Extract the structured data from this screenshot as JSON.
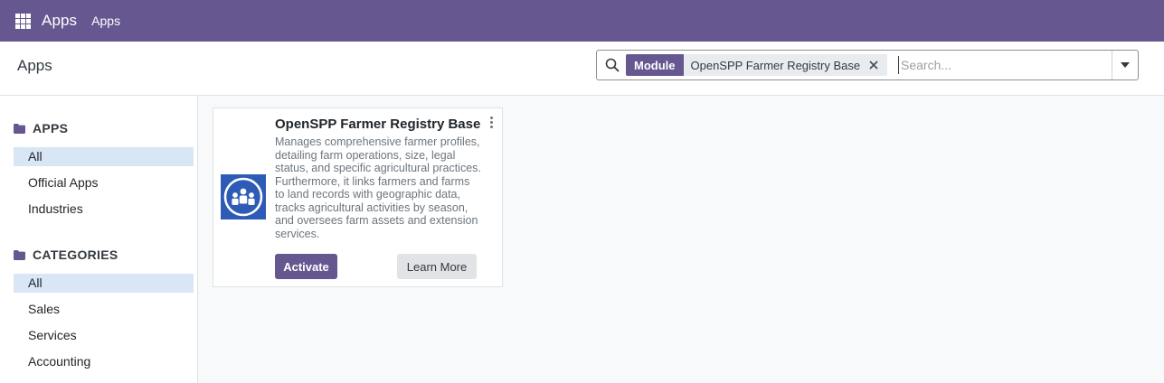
{
  "navbar": {
    "brand": "Apps",
    "menu_item": "Apps",
    "icon": "apps-grid-icon",
    "background": "#665791"
  },
  "control_panel": {
    "title": "Apps",
    "search": {
      "facet_label": "Module",
      "facet_value": "OpenSPP Farmer Registry Base",
      "placeholder": "Search..."
    }
  },
  "sidebar": {
    "sections": [
      {
        "header": "APPS",
        "items": [
          {
            "label": "All",
            "active": true
          },
          {
            "label": "Official Apps",
            "active": false
          },
          {
            "label": "Industries",
            "active": false
          }
        ]
      },
      {
        "header": "CATEGORIES",
        "items": [
          {
            "label": "All",
            "active": true
          },
          {
            "label": "Sales",
            "active": false
          },
          {
            "label": "Services",
            "active": false
          },
          {
            "label": "Accounting",
            "active": false
          }
        ]
      }
    ]
  },
  "apps": [
    {
      "title": "OpenSPP Farmer Registry Base",
      "description": "Manages comprehensive farmer profiles, detailing farm operations, size, legal status, and specific agricultural practices. Furthermore, it links farmers and farms to land records with geographic data, tracks agricultural activities by season, and oversees farm assets and extension services.",
      "primary_action": "Activate",
      "secondary_action": "Learn More",
      "logo_color": "#2d5bb5"
    }
  ],
  "colors": {
    "brand": "#665791",
    "active_item": "#d8e6f6",
    "main_bg": "#f8f9fa"
  }
}
